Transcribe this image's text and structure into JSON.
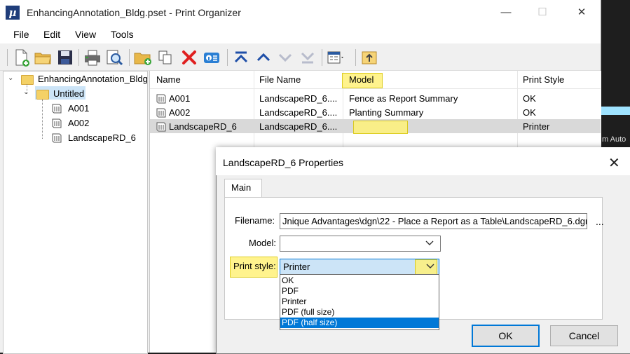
{
  "window": {
    "title": "EnhancingAnnotation_Bldg.pset - Print Organizer",
    "app_icon_glyph": "µ",
    "minimize": "—",
    "maximize": "☐",
    "close": "✕"
  },
  "menu": [
    "File",
    "Edit",
    "View",
    "Tools"
  ],
  "toolbar": {
    "icons": [
      "new-icon",
      "open-icon",
      "save-icon",
      "print-icon",
      "print-preview-icon",
      "add-folder-icon",
      "copy-icon",
      "delete-icon",
      "properties-icon",
      "move-top-icon",
      "move-up-icon",
      "move-down-icon",
      "move-bottom-icon",
      "view-options-icon",
      "export-icon"
    ]
  },
  "tree": {
    "root": "EnhancingAnnotation_Bldg",
    "folder": "Untitled",
    "items": [
      "A001",
      "A002",
      "LandscapeRD_6"
    ]
  },
  "list": {
    "columns": [
      "Name",
      "File Name",
      "Model",
      "Print Style"
    ],
    "rows": [
      {
        "name": "A001",
        "file": "LandscapeRD_6....",
        "model": "Fence as Report Summary",
        "style": "OK"
      },
      {
        "name": "A002",
        "file": "LandscapeRD_6....",
        "model": "Planting Summary",
        "style": "OK"
      },
      {
        "name": "LandscapeRD_6",
        "file": "LandscapeRD_6....",
        "model": "",
        "style": "Printer"
      }
    ]
  },
  "background": {
    "text": "m Auto"
  },
  "dialog": {
    "title": "LandscapeRD_6 Properties",
    "close": "✕",
    "tab": "Main",
    "filename_label": "Filename:",
    "filename_value": "Jnique Advantages\\dgn\\22 - Place a Report as a Table\\LandscapeRD_6.dgn",
    "browse": "...",
    "model_label": "Model:",
    "model_value": "",
    "print_style_label": "Print style:",
    "print_style_value": "Printer",
    "options": [
      "OK",
      "PDF",
      "Printer",
      "PDF (full size)",
      "PDF (half size)"
    ],
    "selected_option_index": 4,
    "ok": "OK",
    "cancel": "Cancel"
  },
  "colors": {
    "accent": "#0078d7",
    "highlight": "#fff27a",
    "selection": "#cce4f7"
  }
}
